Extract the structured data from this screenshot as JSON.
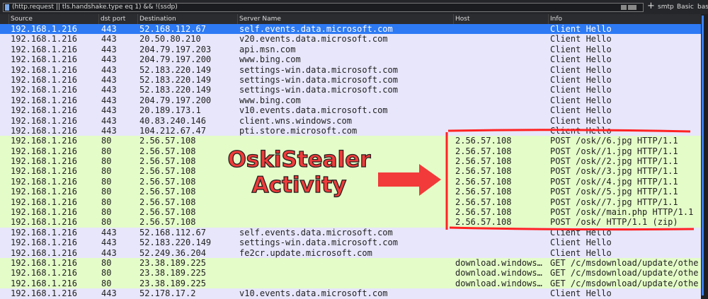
{
  "filter": {
    "expression": "(http.request || tls.handshake.type eq 1) && !(ssdp)"
  },
  "toolbar": {
    "plus": "+",
    "smtp": "smtp",
    "basic": "Basic",
    "basic2": "basi"
  },
  "columns": [
    "Source",
    "dst port",
    "Destination",
    "Server Name",
    "Host",
    "Info"
  ],
  "rows": [
    {
      "t": "sel",
      "c": [
        "192.168.1.216",
        "443",
        "52.168.112.67",
        "self.events.data.microsoft.com",
        "",
        "Client Hello"
      ]
    },
    {
      "t": "tls",
      "c": [
        "192.168.1.216",
        "443",
        "20.50.80.210",
        "v20.events.data.microsoft.com",
        "",
        "Client Hello"
      ]
    },
    {
      "t": "tls",
      "c": [
        "192.168.1.216",
        "443",
        "204.79.197.203",
        "api.msn.com",
        "",
        "Client Hello"
      ]
    },
    {
      "t": "tls",
      "c": [
        "192.168.1.216",
        "443",
        "204.79.197.200",
        "www.bing.com",
        "",
        "Client Hello"
      ]
    },
    {
      "t": "tls",
      "c": [
        "192.168.1.216",
        "443",
        "52.183.220.149",
        "settings-win.data.microsoft.com",
        "",
        "Client Hello"
      ]
    },
    {
      "t": "tls",
      "c": [
        "192.168.1.216",
        "443",
        "52.183.220.149",
        "settings-win.data.microsoft.com",
        "",
        "Client Hello"
      ]
    },
    {
      "t": "tls",
      "c": [
        "192.168.1.216",
        "443",
        "52.183.220.149",
        "settings-win.data.microsoft.com",
        "",
        "Client Hello"
      ]
    },
    {
      "t": "tls",
      "c": [
        "192.168.1.216",
        "443",
        "204.79.197.200",
        "www.bing.com",
        "",
        "Client Hello"
      ]
    },
    {
      "t": "tls",
      "c": [
        "192.168.1.216",
        "443",
        "20.189.173.1",
        "v10.events.data.microsoft.com",
        "",
        "Client Hello"
      ]
    },
    {
      "t": "tls",
      "c": [
        "192.168.1.216",
        "443",
        "40.83.240.146",
        "client.wns.windows.com",
        "",
        "Client Hello"
      ]
    },
    {
      "t": "tls",
      "c": [
        "192.168.1.216",
        "443",
        "104.212.67.47",
        "pti.store.microsoft.com",
        "",
        "Client Hello"
      ]
    },
    {
      "t": "http",
      "c": [
        "192.168.1.216",
        "80",
        "2.56.57.108",
        "",
        "2.56.57.108",
        "POST /osk//6.jpg HTTP/1.1"
      ]
    },
    {
      "t": "http",
      "c": [
        "192.168.1.216",
        "80",
        "2.56.57.108",
        "",
        "2.56.57.108",
        "POST /osk//1.jpg HTTP/1.1"
      ]
    },
    {
      "t": "http",
      "c": [
        "192.168.1.216",
        "80",
        "2.56.57.108",
        "",
        "2.56.57.108",
        "POST /osk//2.jpg HTTP/1.1"
      ]
    },
    {
      "t": "http",
      "c": [
        "192.168.1.216",
        "80",
        "2.56.57.108",
        "",
        "2.56.57.108",
        "POST /osk//3.jpg HTTP/1.1"
      ]
    },
    {
      "t": "http",
      "c": [
        "192.168.1.216",
        "80",
        "2.56.57.108",
        "",
        "2.56.57.108",
        "POST /osk//4.jpg HTTP/1.1"
      ]
    },
    {
      "t": "http",
      "c": [
        "192.168.1.216",
        "80",
        "2.56.57.108",
        "",
        "2.56.57.108",
        "POST /osk//5.jpg HTTP/1.1"
      ]
    },
    {
      "t": "http",
      "c": [
        "192.168.1.216",
        "80",
        "2.56.57.108",
        "",
        "2.56.57.108",
        "POST /osk//7.jpg HTTP/1.1"
      ]
    },
    {
      "t": "http",
      "c": [
        "192.168.1.216",
        "80",
        "2.56.57.108",
        "",
        "2.56.57.108",
        "POST /osk//main.php HTTP/1.1"
      ]
    },
    {
      "t": "http",
      "c": [
        "192.168.1.216",
        "80",
        "2.56.57.108",
        "",
        "2.56.57.108",
        "POST /osk/ HTTP/1.1  (zip)"
      ]
    },
    {
      "t": "tls",
      "c": [
        "192.168.1.216",
        "443",
        "52.168.112.67",
        "self.events.data.microsoft.com",
        "",
        "Client Hello"
      ]
    },
    {
      "t": "tls",
      "c": [
        "192.168.1.216",
        "443",
        "52.183.220.149",
        "settings-win.data.microsoft.com",
        "",
        "Client Hello"
      ]
    },
    {
      "t": "tls",
      "c": [
        "192.168.1.216",
        "443",
        "52.249.36.204",
        "fe2cr.update.microsoft.com",
        "",
        "Client Hello"
      ]
    },
    {
      "t": "http",
      "c": [
        "192.168.1.216",
        "80",
        "23.38.189.225",
        "",
        "download.windows…",
        "GET /c/msdownload/update/othe"
      ]
    },
    {
      "t": "http",
      "c": [
        "192.168.1.216",
        "80",
        "23.38.189.225",
        "",
        "download.windows…",
        "GET /c/msdownload/update/othe"
      ]
    },
    {
      "t": "http",
      "c": [
        "192.168.1.216",
        "80",
        "23.38.189.225",
        "",
        "download.windows…",
        "GET /c/msdownload/update/othe"
      ]
    },
    {
      "t": "tls",
      "c": [
        "192.168.1.216",
        "443",
        "52.178.17.2",
        "v10.events.data.microsoft.com",
        "",
        "Client Hello"
      ]
    }
  ],
  "annotation": {
    "line1": "OskiStealer",
    "line2": "Activity",
    "color": "#f23a3a"
  }
}
